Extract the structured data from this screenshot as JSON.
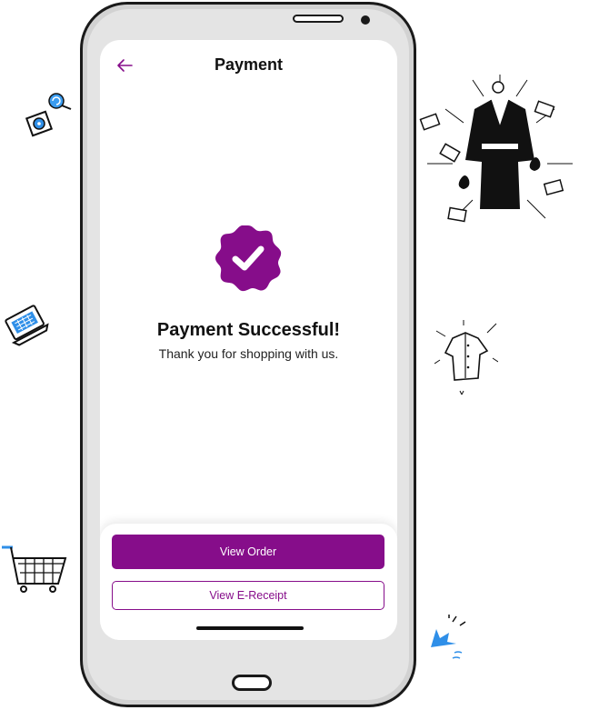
{
  "header": {
    "title": "Payment",
    "back_icon": "arrow-left-icon"
  },
  "status": {
    "title": "Payment Successful!",
    "message": "Thank you for shopping with us.",
    "icon": "check-badge-icon"
  },
  "actions": {
    "view_order_label": "View Order",
    "view_receipt_label": "View E-Receipt"
  },
  "colors": {
    "accent": "#860d8a",
    "text": "#111111",
    "background": "#ffffff"
  }
}
